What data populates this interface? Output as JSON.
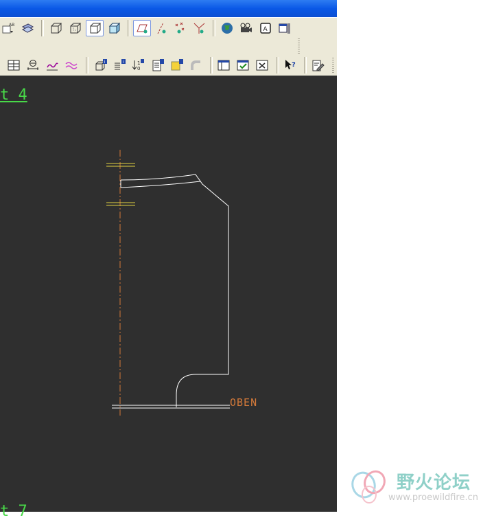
{
  "toolbar": {
    "row1": [
      {
        "name": "note-ab-icon"
      },
      {
        "name": "layers-icon"
      },
      {
        "name": "wireframe-box-icon"
      },
      {
        "name": "hidden-line-box-icon"
      },
      {
        "name": "no-hidden-box-icon"
      },
      {
        "name": "shaded-box-icon"
      },
      {
        "name": "datum-plane-display-icon"
      },
      {
        "name": "datum-axis-display-icon"
      },
      {
        "name": "datum-point-display-icon"
      },
      {
        "name": "coordinate-system-display-icon"
      },
      {
        "name": "globe-icon"
      },
      {
        "name": "camera-icon"
      },
      {
        "name": "annotation-a-icon"
      },
      {
        "name": "window-list-icon"
      }
    ],
    "row2": [
      {
        "name": "table-icon"
      },
      {
        "name": "dimension-icon"
      },
      {
        "name": "spring-icon"
      },
      {
        "name": "wave-icon"
      },
      {
        "name": "model-info-icon"
      },
      {
        "name": "list-info-icon"
      },
      {
        "name": "sort-icon"
      },
      {
        "name": "document-info-icon"
      },
      {
        "name": "note-info-icon"
      },
      {
        "name": "pipe-icon"
      },
      {
        "name": "window-tile-icon"
      },
      {
        "name": "window-check-icon"
      },
      {
        "name": "window-close-icon"
      },
      {
        "name": "whats-this-help-icon"
      },
      {
        "name": "edit-document-icon"
      }
    ]
  },
  "drawing": {
    "view_label_top": "t 4",
    "view_label_bottom": "t 7",
    "annotation": "OBEN"
  },
  "colors": {
    "canvas_bg": "#2f2f2f",
    "geometry": "#ffffff",
    "centerline": "#d47a3a",
    "datum": "#e0d040",
    "view_label": "#48d848"
  },
  "watermark": {
    "title": "野火论坛",
    "url": "www.proewildfire.cn"
  }
}
